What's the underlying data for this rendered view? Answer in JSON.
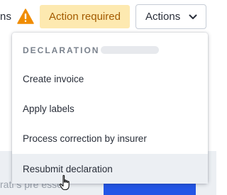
{
  "toolbar": {
    "cut_text": "ns",
    "status_badge": "Action required",
    "actions_label": "Actions",
    "warning_icon": "warning-triangle-icon",
    "chevron_icon": "chevron-down-icon"
  },
  "menu": {
    "header": "DECLARATION",
    "items": [
      {
        "label": "Create invoice"
      },
      {
        "label": "Apply labels"
      },
      {
        "label": "Process correction by insurer"
      },
      {
        "label": "Resubmit declaration"
      }
    ],
    "hovered_item": "Resubmit declaration"
  },
  "background": {
    "partial_text": "rati     s pre essed"
  },
  "colors": {
    "warning": "#f08c00",
    "badge_bg": "#fde9b0",
    "badge_text": "#a35a00",
    "primary": "#2456e6"
  }
}
